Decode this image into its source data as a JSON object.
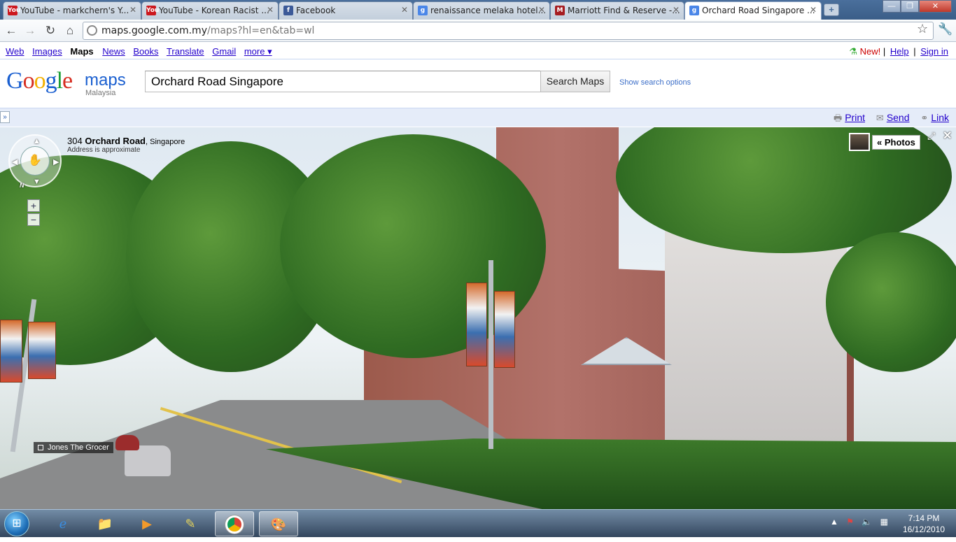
{
  "browser": {
    "tabs": [
      {
        "title": "YouTube - markchern's Y...",
        "favicon": "youtube-icon",
        "color": "#cc181e",
        "label": "You"
      },
      {
        "title": "YouTube - Korean Racist ...",
        "favicon": "youtube-icon",
        "color": "#cc181e",
        "label": "You"
      },
      {
        "title": "Facebook",
        "favicon": "facebook-icon",
        "color": "#3b5998",
        "label": "f"
      },
      {
        "title": "renaissance melaka hotel...",
        "favicon": "google-icon",
        "color": "#4a86e8",
        "label": "g"
      },
      {
        "title": "Marriott Find & Reserve -...",
        "favicon": "marriott-icon",
        "color": "#a61c20",
        "label": "M"
      },
      {
        "title": "Orchard Road Singapore ...",
        "favicon": "google-maps-icon",
        "color": "#4a86e8",
        "label": "g",
        "active": true
      }
    ],
    "new_tab": "+",
    "window_controls": {
      "minimize": "—",
      "maximize": "❐",
      "close": "✕"
    },
    "url_host": "maps.google.com.my",
    "url_path": "/maps?hl=en&tab=wl"
  },
  "gbar": {
    "links": [
      "Web",
      "Images",
      "Maps",
      "News",
      "Books",
      "Translate",
      "Gmail",
      "more ▾"
    ],
    "current": "Maps",
    "new_label": "New!",
    "help": "Help",
    "signin": "Sign in",
    "separator": "|"
  },
  "header": {
    "logo_google": [
      "G",
      "o",
      "o",
      "g",
      "l",
      "e"
    ],
    "logo_maps": "maps",
    "logo_country": "Malaysia",
    "search_value": "Orchard Road Singapore",
    "search_button": "Search Maps",
    "search_options": "Show search options"
  },
  "panelbar": {
    "collapse": "»",
    "print": "Print",
    "send": "Send",
    "link": "Link"
  },
  "streetview": {
    "address_number": "304 ",
    "address_street": "Orchard Road",
    "address_city": ", Singapore",
    "address_note": "Address is approximate",
    "compass": "N",
    "zoom_in": "+",
    "zoom_out": "−",
    "photos_button": "« Photos",
    "poi_label": "Jones The Grocer"
  },
  "taskbar": {
    "clock_time": "7:14 PM",
    "clock_date": "16/12/2010",
    "tray_icons": [
      "show-hidden-icon",
      "flag-icon",
      "volume-icon",
      "network-icon"
    ]
  }
}
